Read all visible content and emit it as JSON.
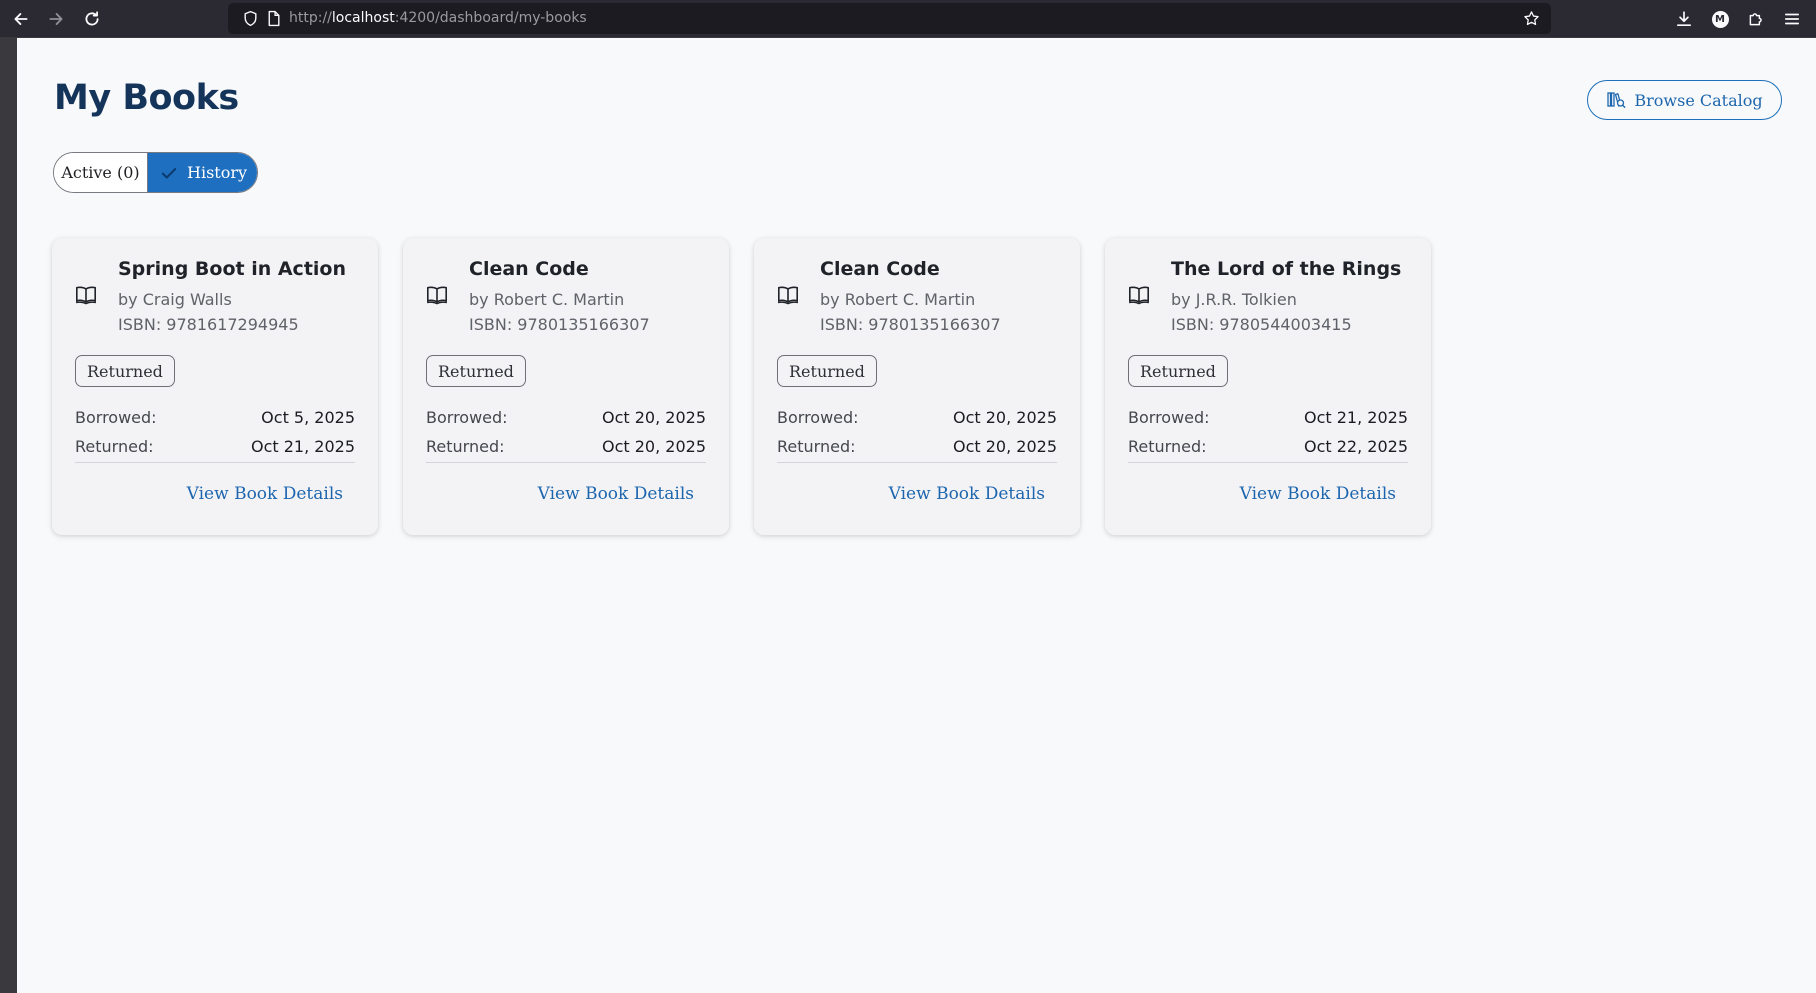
{
  "browser": {
    "url_prefix": "http://",
    "url_host": "localhost",
    "url_rest": ":4200/dashboard/my-books",
    "profile_initial": "M"
  },
  "page": {
    "title": "My Books",
    "browse_label": "Browse Catalog"
  },
  "tabs": {
    "active_label": "Active (0)",
    "history_label": "History",
    "selected": "History"
  },
  "cards": [
    {
      "title": "Spring Boot in Action",
      "author": "by Craig Walls",
      "isbn": "ISBN: 9781617294945",
      "status": "Returned",
      "borrowed_label": "Borrowed:",
      "borrowed": "Oct 5, 2025",
      "returned_label": "Returned:",
      "returned": "Oct 21, 2025",
      "link": "View Book Details"
    },
    {
      "title": "Clean Code",
      "author": "by Robert C. Martin",
      "isbn": "ISBN: 9780135166307",
      "status": "Returned",
      "borrowed_label": "Borrowed:",
      "borrowed": "Oct 20, 2025",
      "returned_label": "Returned:",
      "returned": "Oct 20, 2025",
      "link": "View Book Details"
    },
    {
      "title": "Clean Code",
      "author": "by Robert C. Martin",
      "isbn": "ISBN: 9780135166307",
      "status": "Returned",
      "borrowed_label": "Borrowed:",
      "borrowed": "Oct 20, 2025",
      "returned_label": "Returned:",
      "returned": "Oct 20, 2025",
      "link": "View Book Details"
    },
    {
      "title": "The Lord of the Rings",
      "author": "by J.R.R. Tolkien",
      "isbn": "ISBN: 9780544003415",
      "status": "Returned",
      "borrowed_label": "Borrowed:",
      "borrowed": "Oct 21, 2025",
      "returned_label": "Returned:",
      "returned": "Oct 22, 2025",
      "link": "View Book Details"
    }
  ],
  "icons": {
    "back": "arrow-left-icon",
    "forward": "arrow-right-icon",
    "reload": "reload-icon",
    "site_info": "shield-icon",
    "page": "page-icon",
    "bookmark": "star-icon",
    "downloads": "download-icon",
    "extensions": "puzzle-icon",
    "menu": "hamburger-menu-icon",
    "catalog": "catalog-icon",
    "check": "check-icon",
    "book": "open-book-icon"
  },
  "colors": {
    "primary": "#1f6fc0",
    "title": "#14345a",
    "link": "#1d66ae",
    "page_bg": "#f8f9fb",
    "card_bg": "#f3f3f6"
  }
}
